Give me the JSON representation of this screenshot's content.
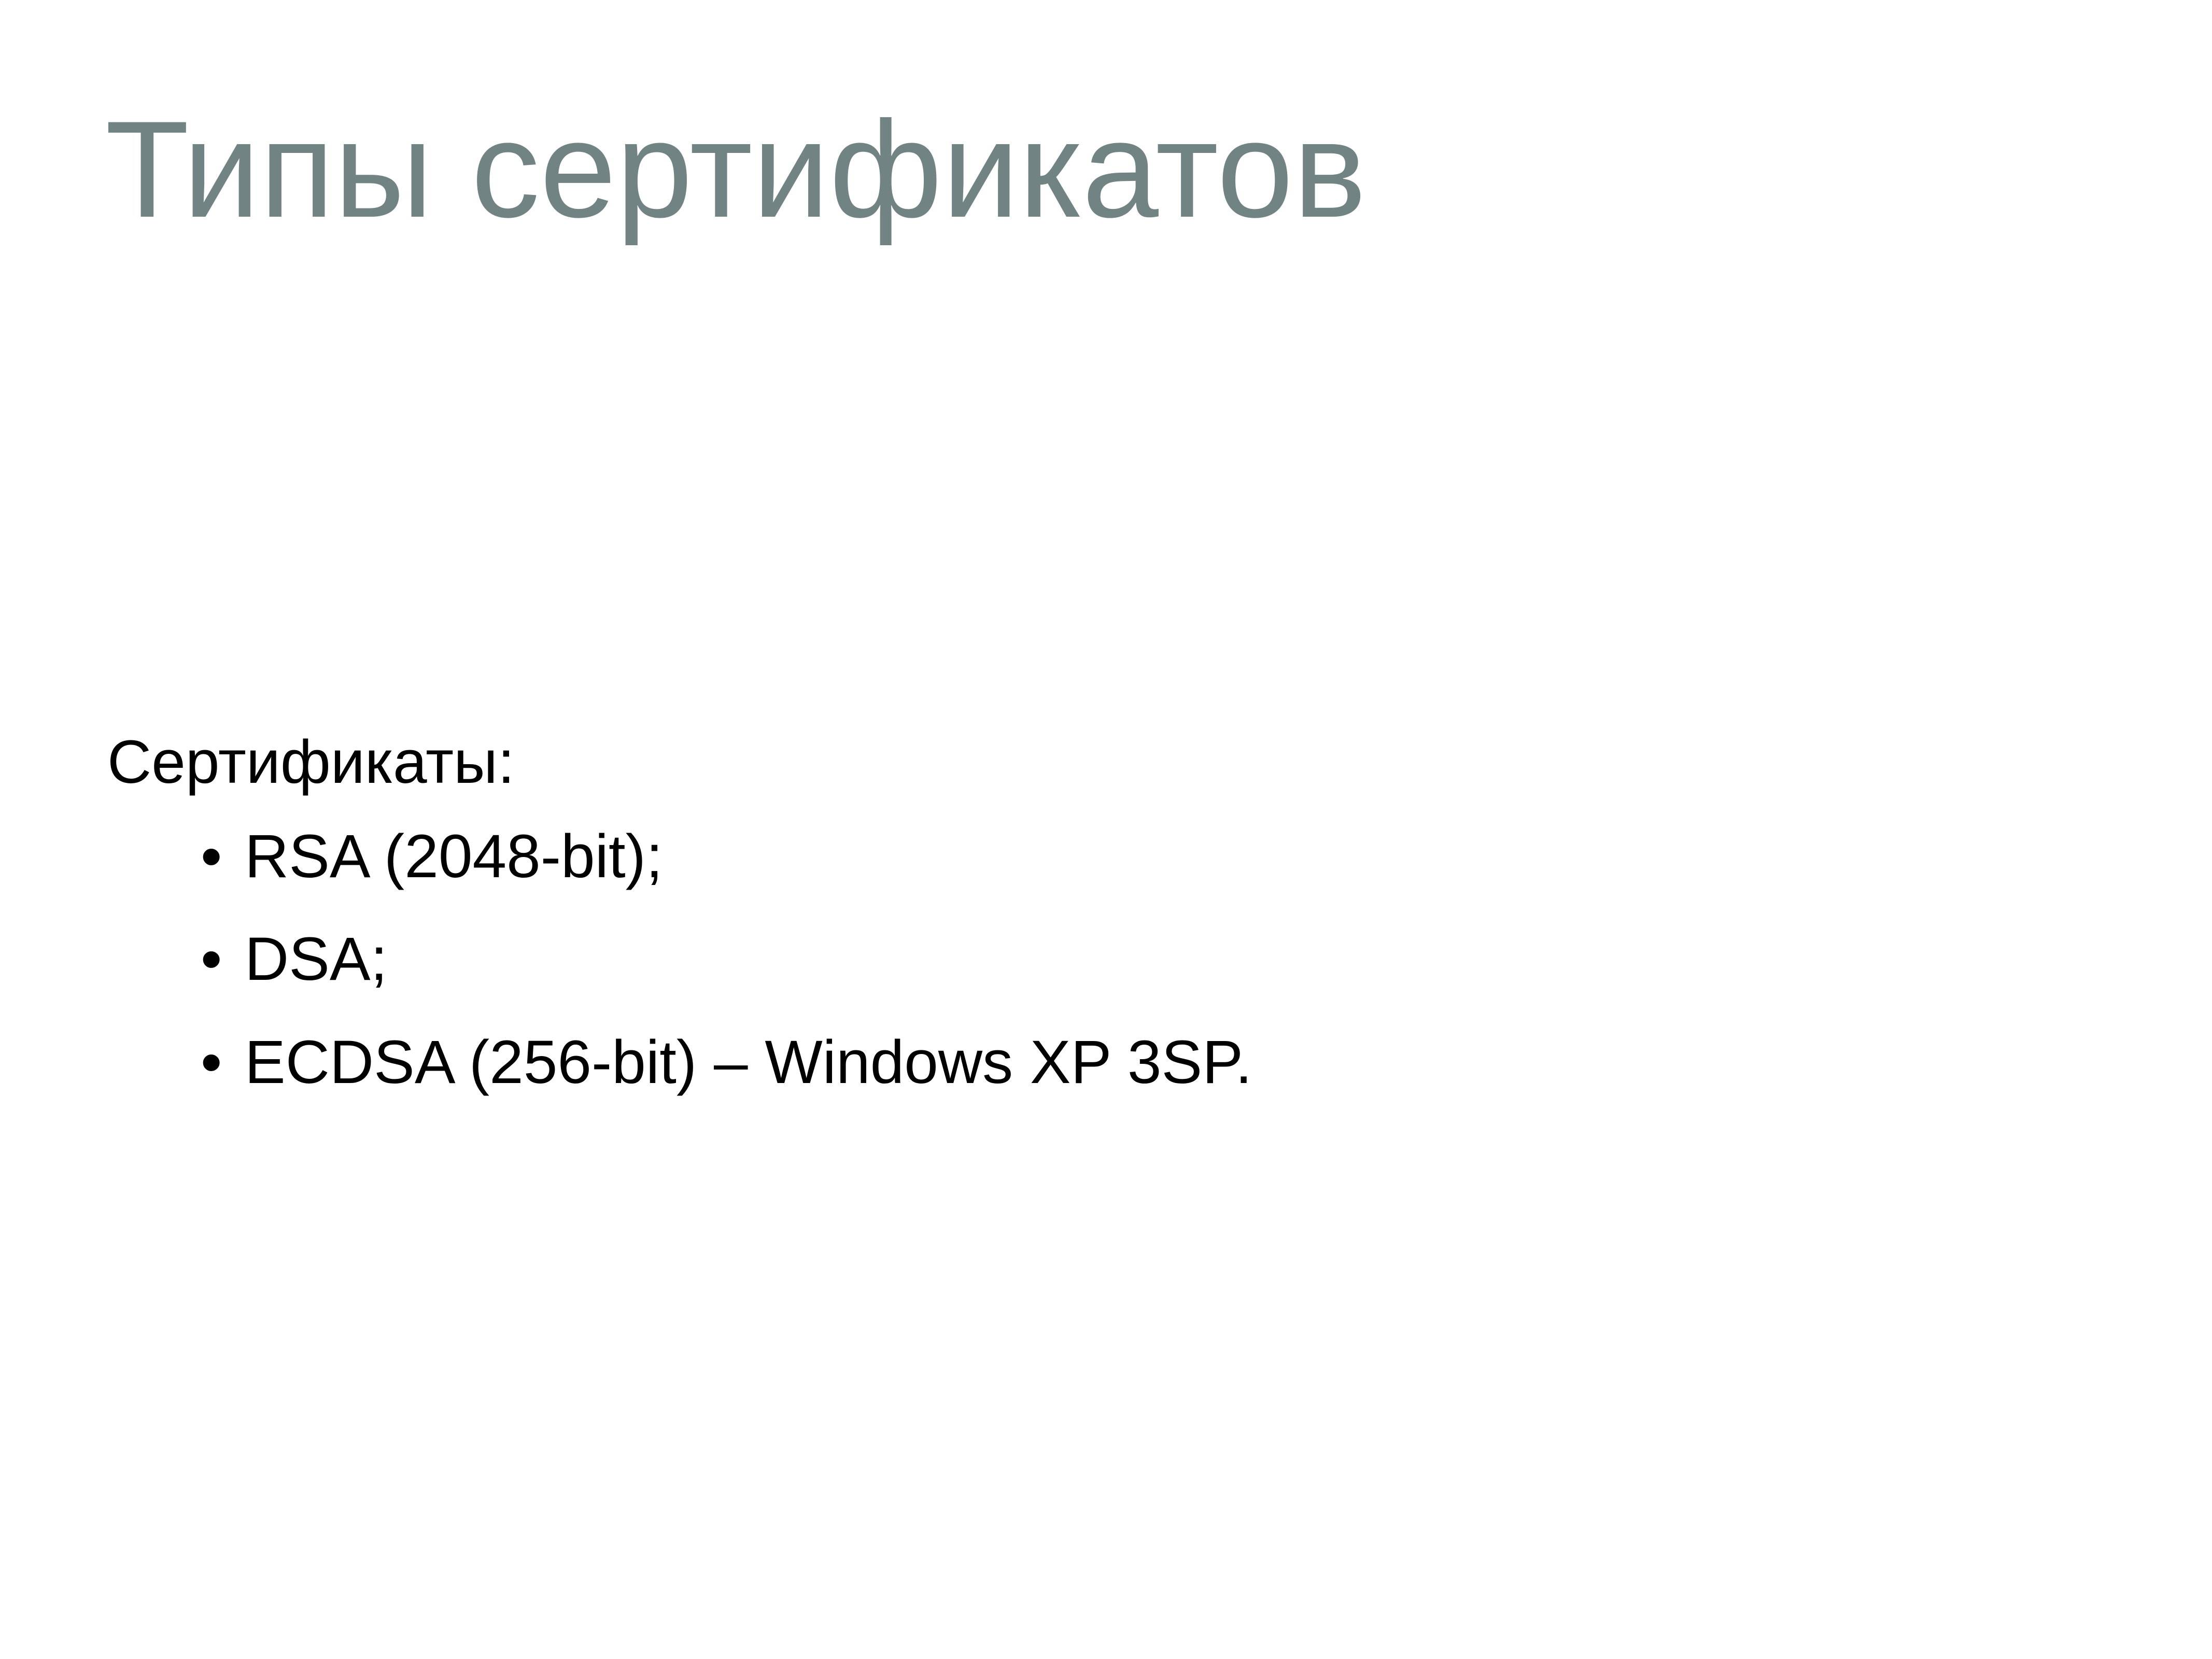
{
  "slide": {
    "title": "Типы сертификатов",
    "intro": "Сертификаты:",
    "bullet_glyph": "•",
    "items": [
      "RSA (2048-bit);",
      "DSA;",
      "ECDSA (256-bit) – Windows XP 3SP."
    ]
  },
  "colors": {
    "title": "#728384",
    "text": "#000000",
    "background": "#ffffff"
  }
}
